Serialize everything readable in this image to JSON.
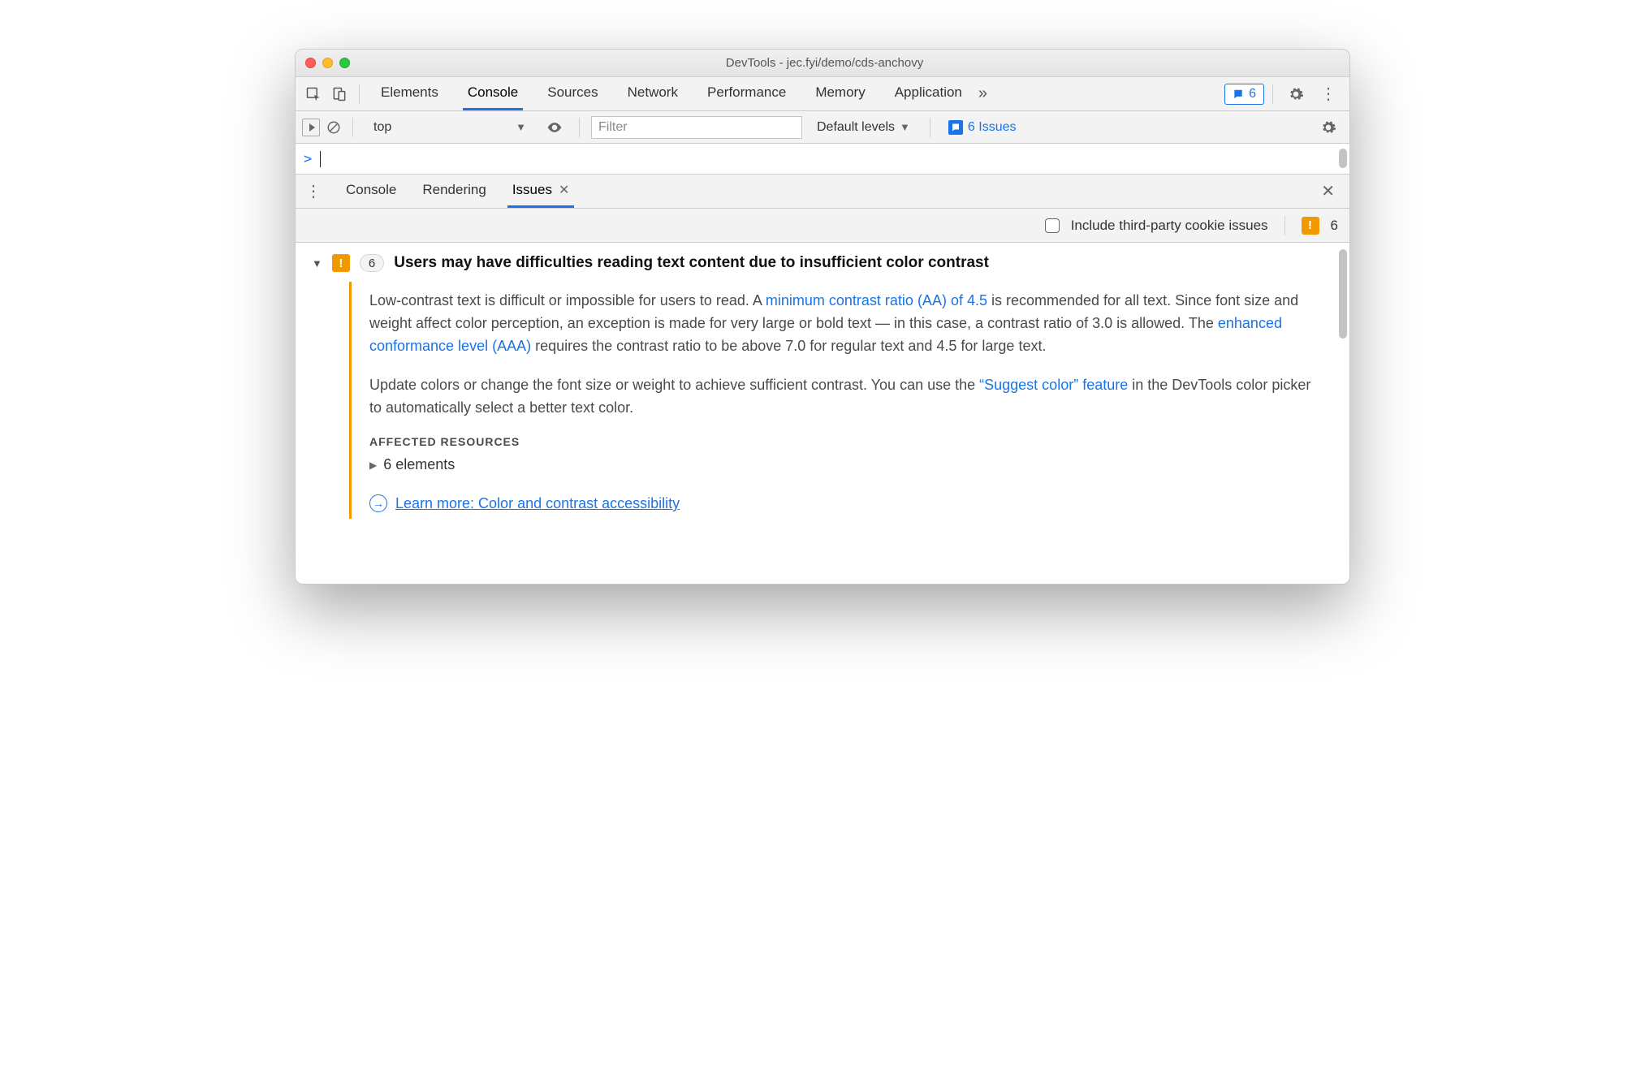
{
  "window": {
    "title": "DevTools - jec.fyi/demo/cds-anchovy"
  },
  "tabs": {
    "items": [
      "Elements",
      "Console",
      "Sources",
      "Network",
      "Performance",
      "Memory",
      "Application"
    ],
    "active": "Console",
    "issues_badge": "6"
  },
  "console_bar": {
    "context": "top",
    "filter_placeholder": "Filter",
    "levels": "Default levels",
    "issues_label": "6 Issues"
  },
  "drawer": {
    "tabs": [
      "Console",
      "Rendering",
      "Issues"
    ],
    "active": "Issues"
  },
  "issues_toolbar": {
    "include_cookies_label": "Include third-party cookie issues",
    "total_count": "6"
  },
  "issue": {
    "count": "6",
    "title": "Users may have difficulties reading text content due to insufficient color contrast",
    "p1_pre": "Low-contrast text is difficult or impossible for users to read. A ",
    "p1_link1": "minimum contrast ratio (AA) of 4.5",
    "p1_mid": " is recommended for all text. Since font size and weight affect color perception, an exception is made for very large or bold text — in this case, a contrast ratio of 3.0 is allowed. The ",
    "p1_link2": "enhanced conformance level (AAA)",
    "p1_post": " requires the contrast ratio to be above 7.0 for regular text and 4.5 for large text.",
    "p2_pre": "Update colors or change the font size or weight to achieve sufficient contrast. You can use the ",
    "p2_link": "“Suggest color” feature",
    "p2_post": " in the DevTools color picker to automatically select a better text color.",
    "affected_heading": "AFFECTED RESOURCES",
    "affected_elements": "6 elements",
    "learn_more": "Learn more: Color and contrast accessibility"
  }
}
